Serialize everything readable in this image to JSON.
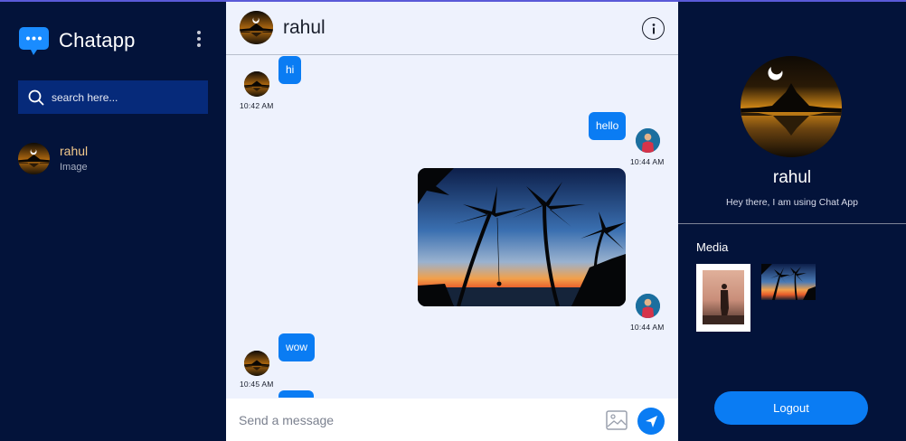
{
  "app": {
    "name": "Chatapp",
    "brand_icon": "chat-bubble-icon",
    "menu_icon": "kebab-menu-icon"
  },
  "search": {
    "placeholder": "search here...",
    "icon": "search-icon"
  },
  "contacts": [
    {
      "name": "rahul",
      "last_message": "Image"
    }
  ],
  "chat": {
    "title": "rahul",
    "info_icon": "info-icon",
    "messages": [
      {
        "from": "them",
        "type": "text",
        "text": "hi",
        "time": "10:42 AM"
      },
      {
        "from": "me",
        "type": "text",
        "text": "hello",
        "time": "10:44 AM"
      },
      {
        "from": "me",
        "type": "image",
        "image": "palm-sunset-photo",
        "time": "10:44 AM"
      },
      {
        "from": "them",
        "type": "text",
        "text": "wow",
        "time": "10:45 AM"
      }
    ],
    "composer": {
      "placeholder": "Send a message",
      "image_icon": "image-icon",
      "send_icon": "send-icon"
    }
  },
  "profile": {
    "name": "rahul",
    "status": "Hey there, I am using Chat App",
    "media_title": "Media",
    "media": [
      "person-photo",
      "palm-sunset-photo"
    ],
    "logout_label": "Logout"
  },
  "colors": {
    "accent": "#0a7cf3",
    "sidebar_bg": "#03133a",
    "chat_bg": "#eef2fd",
    "contact_name": "#f3c98b",
    "search_bg": "#062a7a"
  }
}
